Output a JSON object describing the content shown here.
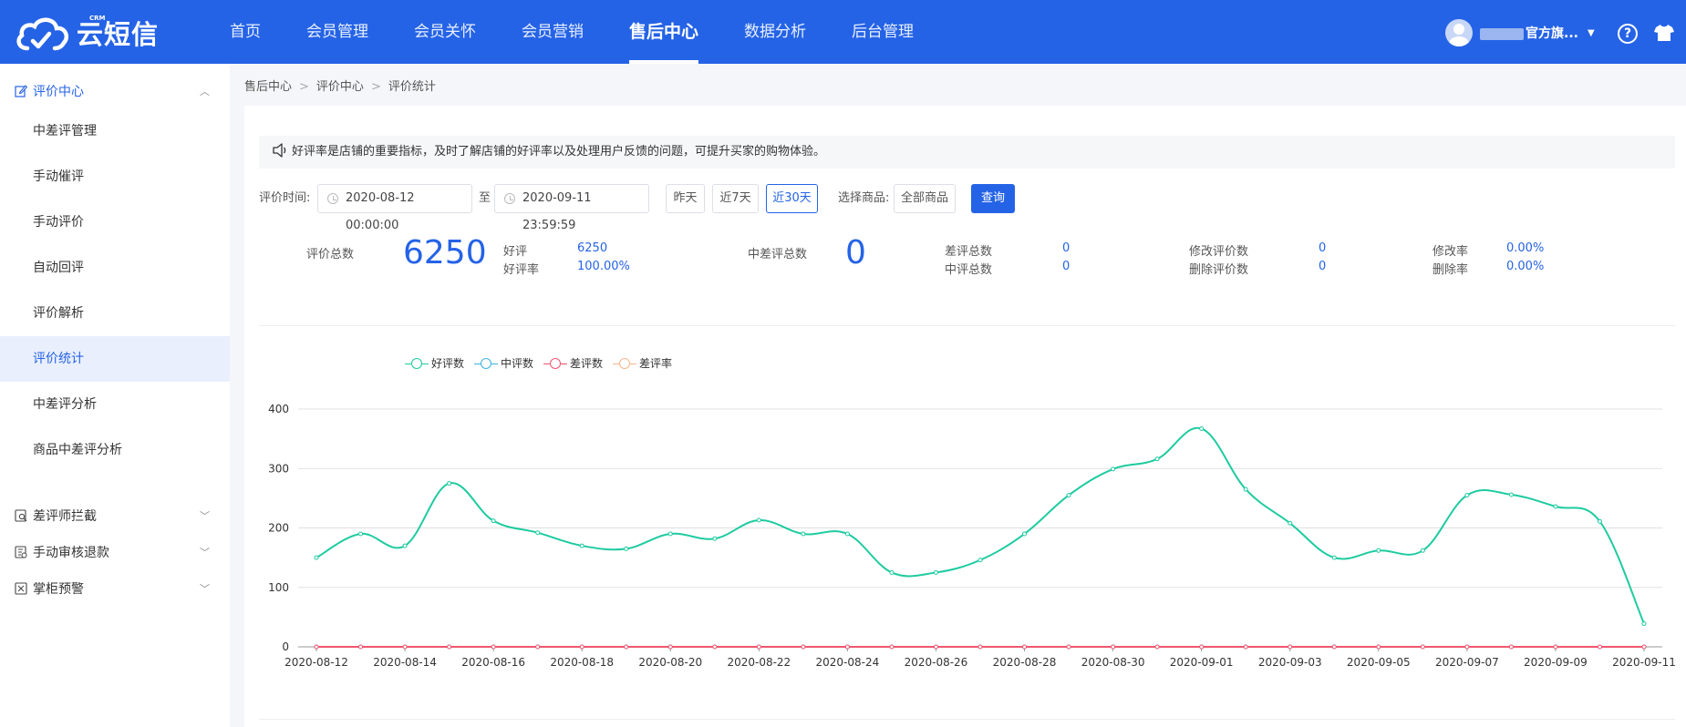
{
  "brand": {
    "name": "云短信",
    "badge": "CRM"
  },
  "nav": {
    "items": [
      {
        "label": "首页",
        "active": false
      },
      {
        "label": "会员管理",
        "active": false
      },
      {
        "label": "会员关怀",
        "active": false
      },
      {
        "label": "会员营销",
        "active": false
      },
      {
        "label": "售后中心",
        "active": true
      },
      {
        "label": "数据分析",
        "active": false
      },
      {
        "label": "后台管理",
        "active": false
      }
    ],
    "user_suffix": "官方旗...",
    "help_icon": "question-circle-icon",
    "theme_icon": "shirt-icon"
  },
  "sidebar": {
    "groups": [
      {
        "label": "评价中心",
        "icon": "edit-icon",
        "expanded": true
      },
      {
        "label": "差评师拦截",
        "icon": "shield-search-icon",
        "expanded": false
      },
      {
        "label": "手动审核退款",
        "icon": "refund-icon",
        "expanded": false
      },
      {
        "label": "掌柜预警",
        "icon": "warning-icon",
        "expanded": false
      }
    ],
    "items": [
      {
        "label": "中差评管理"
      },
      {
        "label": "手动催评"
      },
      {
        "label": "手动评价"
      },
      {
        "label": "自动回评"
      },
      {
        "label": "评价解析"
      },
      {
        "label": "评价统计",
        "active": true
      },
      {
        "label": "中差评分析"
      },
      {
        "label": "商品中差评分析"
      }
    ]
  },
  "breadcrumb": [
    "售后中心",
    "评价中心",
    "评价统计"
  ],
  "notice": "好评率是店铺的重要指标，及时了解店铺的好评率以及处理用户反馈的问题，可提升买家的购物体验。",
  "filters": {
    "time_label": "评价时间:",
    "start": "2020-08-12 00:00:00",
    "to": "至",
    "end": "2020-09-11 23:59:59",
    "quick": [
      {
        "label": "昨天",
        "selected": false
      },
      {
        "label": "近7天",
        "selected": false
      },
      {
        "label": "近30天",
        "selected": true
      }
    ],
    "product_label": "选择商品:",
    "product_value": "全部商品",
    "query_label": "查询"
  },
  "stats": {
    "total_label": "评价总数",
    "total_value": "6250",
    "good_label": "好评",
    "good_value": "6250",
    "good_rate_label": "好评率",
    "good_rate_value": "100.00%",
    "midbad_label": "中差评总数",
    "midbad_value": "0",
    "bad_label": "差评总数",
    "bad_value": "0",
    "mid_label": "中评总数",
    "mid_value": "0",
    "modified_label": "修改评价数",
    "modified_value": "0",
    "deleted_label": "删除评价数",
    "deleted_value": "0",
    "modify_rate_label": "修改率",
    "modify_rate_value": "0.00%",
    "delete_rate_label": "删除率",
    "delete_rate_value": "0.00%"
  },
  "colors": {
    "primary": "#2563e6",
    "good": "#1ecba0",
    "mid": "#3fb1e3",
    "bad": "#f0566e",
    "bad_rate": "#f8b58a"
  },
  "chart_data": {
    "type": "line",
    "title": "",
    "xlabel": "",
    "ylabel": "",
    "ylim": [
      0,
      400
    ],
    "yticks": [
      0,
      100,
      200,
      300,
      400
    ],
    "grid": true,
    "legend_position": "top-left",
    "x": [
      "2020-08-12",
      "2020-08-13",
      "2020-08-14",
      "2020-08-15",
      "2020-08-16",
      "2020-08-17",
      "2020-08-18",
      "2020-08-19",
      "2020-08-20",
      "2020-08-21",
      "2020-08-22",
      "2020-08-23",
      "2020-08-24",
      "2020-08-25",
      "2020-08-26",
      "2020-08-27",
      "2020-08-28",
      "2020-08-29",
      "2020-08-30",
      "2020-08-31",
      "2020-09-01",
      "2020-09-02",
      "2020-09-03",
      "2020-09-04",
      "2020-09-05",
      "2020-09-06",
      "2020-09-07",
      "2020-09-08",
      "2020-09-09",
      "2020-09-10",
      "2020-09-11"
    ],
    "xtick_labels": [
      "2020-08-12",
      "2020-08-14",
      "2020-08-16",
      "2020-08-18",
      "2020-08-20",
      "2020-08-22",
      "2020-08-24",
      "2020-08-26",
      "2020-08-28",
      "2020-08-30",
      "2020-09-01",
      "2020-09-03",
      "2020-09-05",
      "2020-09-07",
      "2020-09-09",
      "2020-09-11"
    ],
    "series": [
      {
        "name": "好评数",
        "color": "#1ecba0",
        "values": [
          150,
          190,
          170,
          275,
          212,
          192,
          170,
          165,
          190,
          182,
          213,
          190,
          190,
          125,
          125,
          146,
          190,
          255,
          299,
          316,
          367,
          265,
          208,
          150,
          162,
          162,
          255,
          256,
          236,
          211,
          39
        ]
      },
      {
        "name": "中评数",
        "color": "#3fb1e3",
        "values": [
          0,
          0,
          0,
          0,
          0,
          0,
          0,
          0,
          0,
          0,
          0,
          0,
          0,
          0,
          0,
          0,
          0,
          0,
          0,
          0,
          0,
          0,
          0,
          0,
          0,
          0,
          0,
          0,
          0,
          0,
          0
        ]
      },
      {
        "name": "差评数",
        "color": "#f0566e",
        "values": [
          0,
          0,
          0,
          0,
          0,
          0,
          0,
          0,
          0,
          0,
          0,
          0,
          0,
          0,
          0,
          0,
          0,
          0,
          0,
          0,
          0,
          0,
          0,
          0,
          0,
          0,
          0,
          0,
          0,
          0,
          0
        ]
      },
      {
        "name": "差评率",
        "color": "#f8b58a",
        "values": []
      }
    ]
  }
}
